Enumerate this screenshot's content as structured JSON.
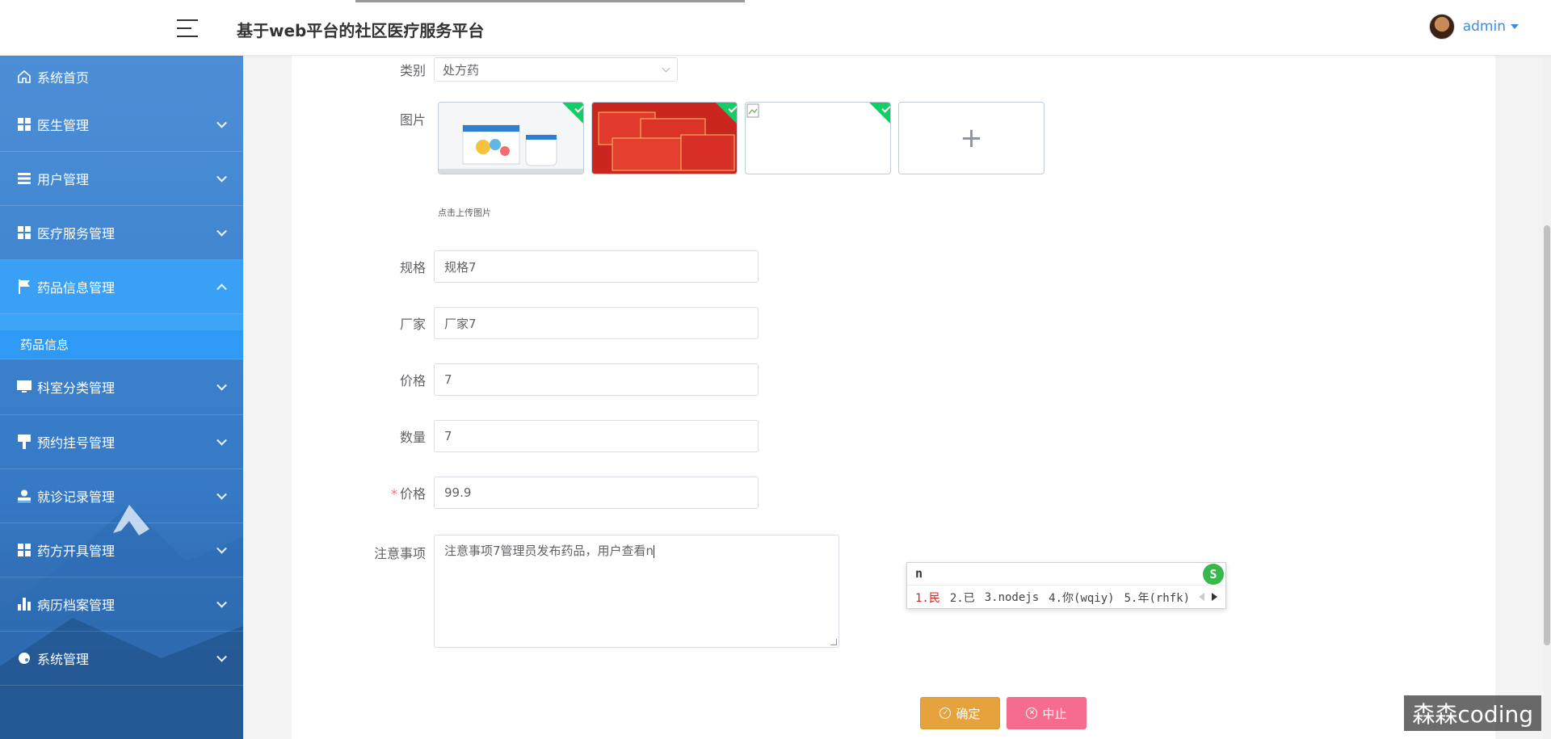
{
  "header": {
    "title": "基于web平台的社区医疗服务平台",
    "user": "admin"
  },
  "sidebar": {
    "items": [
      {
        "label": "系统首页",
        "icon": "home-icon"
      },
      {
        "label": "医生管理",
        "icon": "grid-icon"
      },
      {
        "label": "用户管理",
        "icon": "list-icon"
      },
      {
        "label": "医疗服务管理",
        "icon": "grid-icon"
      },
      {
        "label": "药品信息管理",
        "icon": "flag-icon",
        "active": true
      },
      {
        "label": "科室分类管理",
        "icon": "monitor-icon"
      },
      {
        "label": "预约挂号管理",
        "icon": "brush-icon"
      },
      {
        "label": "就诊记录管理",
        "icon": "stamp-icon"
      },
      {
        "label": "药方开具管理",
        "icon": "grid-icon"
      },
      {
        "label": "病历档案管理",
        "icon": "bar-chart-icon"
      },
      {
        "label": "系统管理",
        "icon": "palette-icon"
      }
    ],
    "submenu": {
      "label": "药品信息"
    }
  },
  "form": {
    "category": {
      "label": "类别",
      "value": "处方药"
    },
    "images": {
      "label": "图片",
      "tip": "点击上传图片",
      "add_symbol": "+"
    },
    "spec": {
      "label": "规格",
      "value": "规格7"
    },
    "manufacturer": {
      "label": "厂家",
      "value": "厂家7"
    },
    "price": {
      "label": "价格",
      "value": "7"
    },
    "quantity": {
      "label": "数量",
      "value": "7"
    },
    "price2": {
      "label": "价格",
      "value": "99.9",
      "required_mark": "*"
    },
    "notes": {
      "label": "注意事项",
      "value": "注意事项7管理员发布药品，用户查看n"
    }
  },
  "ime": {
    "input": "n",
    "logo": "S",
    "candidates": [
      "1.民",
      "2.已",
      "3.nodejs",
      "4.你(wqiy)",
      "5.年(rhfk)"
    ]
  },
  "buttons": {
    "confirm": "确定",
    "stop": "中止"
  },
  "watermark": "森森coding",
  "colors": {
    "accent": "#3a8ee6",
    "sidebar_active": "#3aa0f5",
    "confirm": "#e6a23c",
    "stop": "#f56c8f",
    "upload_success": "#13ce66"
  }
}
